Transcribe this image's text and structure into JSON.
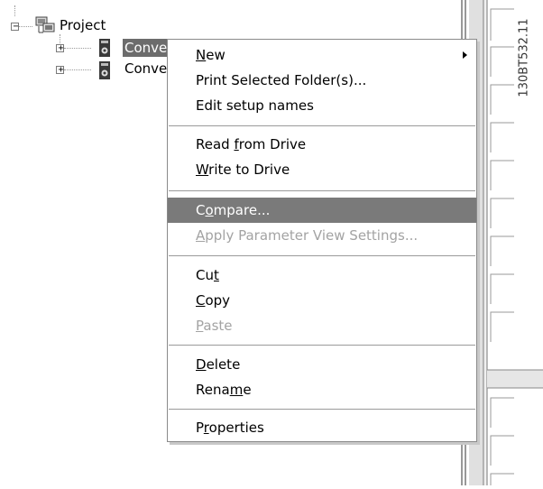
{
  "tree": {
    "root": {
      "label": "Project",
      "expander": "−"
    },
    "children": [
      {
        "label": "Conve",
        "expander": "+"
      },
      {
        "label": "Conve",
        "expander": "+"
      }
    ]
  },
  "context_menu": {
    "items": [
      {
        "label": "New",
        "mnemonic": "N",
        "has_submenu": true,
        "state": "normal"
      },
      {
        "label": "Print Selected Folder(s)...",
        "state": "normal"
      },
      {
        "label": "Edit setup names",
        "state": "normal"
      },
      {
        "label": "Read from Drive",
        "mnemonic": "f",
        "state": "normal"
      },
      {
        "label": "Write to Drive",
        "mnemonic": "W",
        "state": "normal"
      },
      {
        "label": "Compare...",
        "mnemonic": "o",
        "state": "highlighted"
      },
      {
        "label": "Apply Parameter View Settings...",
        "mnemonic": "A",
        "state": "disabled"
      },
      {
        "label": "Cut",
        "mnemonic": "t",
        "state": "normal"
      },
      {
        "label": "Copy",
        "mnemonic": "C",
        "state": "normal"
      },
      {
        "label": "Paste",
        "mnemonic": "P",
        "state": "disabled"
      },
      {
        "label": "Delete",
        "mnemonic": "D",
        "state": "normal"
      },
      {
        "label": "Rename",
        "mnemonic": "m",
        "state": "normal"
      },
      {
        "label": "Properties",
        "mnemonic": "r",
        "state": "normal"
      }
    ]
  },
  "figure_code": "130BT532.11",
  "colors": {
    "highlight": "#7a7a7a",
    "disabled_text": "#a3a3a3",
    "selection": "#6c6c6c"
  }
}
